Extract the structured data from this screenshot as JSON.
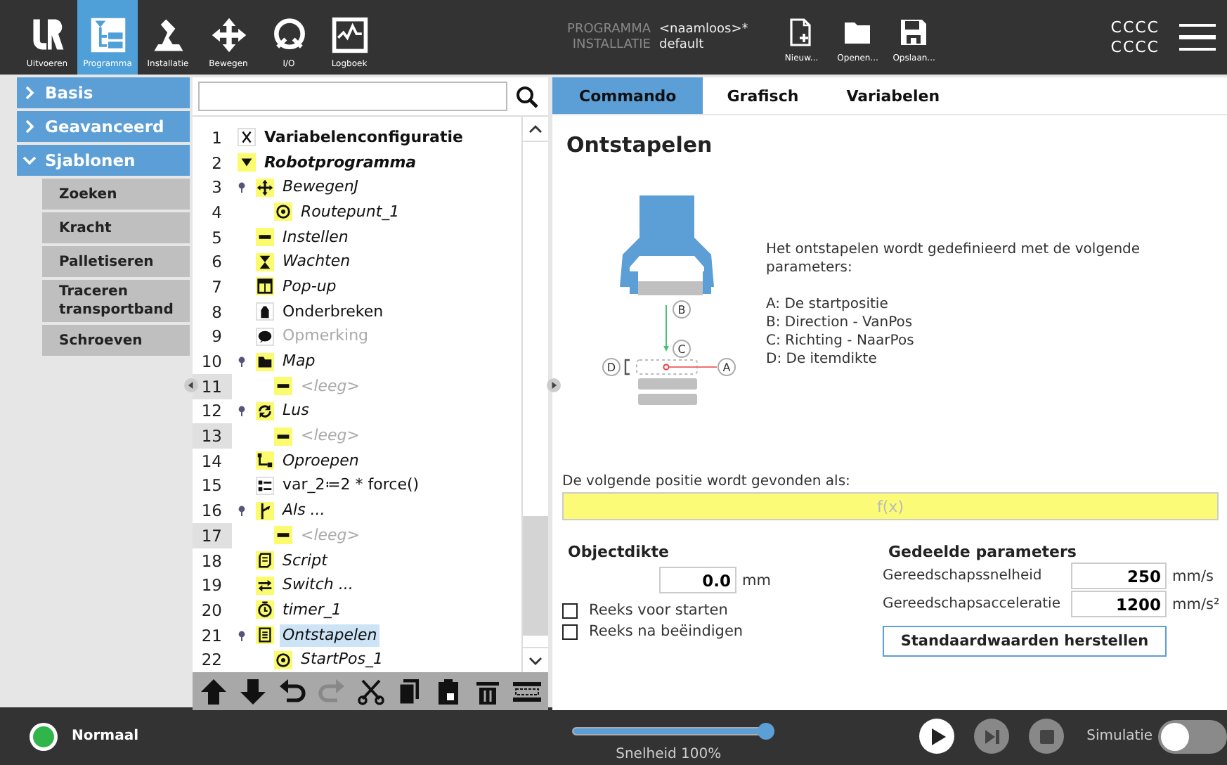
{
  "header": {
    "nav": [
      {
        "label": "Uitvoeren",
        "kind": "logo",
        "selected": false
      },
      {
        "label": "Programma",
        "kind": "program",
        "selected": true
      },
      {
        "label": "Installatie",
        "kind": "robot",
        "selected": false
      },
      {
        "label": "Bewegen",
        "kind": "move",
        "selected": false
      },
      {
        "label": "I/O",
        "kind": "io",
        "selected": false
      },
      {
        "label": "Logboek",
        "kind": "log",
        "selected": false
      }
    ],
    "program_label": "PROGRAMMA",
    "program_name": "<naamloos>*",
    "installation_label": "INSTALLATIE",
    "installation_name": "default",
    "files": [
      {
        "label": "Nieuw...",
        "kind": "new"
      },
      {
        "label": "Openen...",
        "kind": "open"
      },
      {
        "label": "Opslaan...",
        "kind": "save"
      }
    ],
    "user_lines": [
      "CCCC",
      "CCCC"
    ]
  },
  "sidebar": {
    "sections": [
      {
        "label": "Basis",
        "expanded": false
      },
      {
        "label": "Geavanceerd",
        "expanded": false
      },
      {
        "label": "Sjablonen",
        "expanded": true,
        "items": [
          "Zoeken",
          "Kracht",
          "Palletiseren",
          "Traceren transportband",
          "Schroeven"
        ]
      }
    ]
  },
  "tree": {
    "items": [
      {
        "line": "1",
        "label": "Variabelenconfiguratie",
        "kind": "variables",
        "italic": false,
        "disabled": false,
        "selected": false
      },
      {
        "line": "2",
        "label": "Robotprogramma",
        "kind": "program",
        "italic": true,
        "disabled": false,
        "selected": false,
        "children": [
          {
            "line": "3",
            "label": "BewegenJ",
            "kind": "move",
            "italic": true,
            "disabled": false,
            "selected": false,
            "children": [
              {
                "line": "4",
                "label": "Routepunt_1",
                "kind": "waypoint",
                "italic": true,
                "disabled": false,
                "selected": false
              }
            ]
          },
          {
            "line": "5",
            "label": "Instellen",
            "kind": "set",
            "italic": true,
            "disabled": false,
            "selected": false
          },
          {
            "line": "6",
            "label": "Wachten",
            "kind": "wait",
            "italic": true,
            "disabled": false,
            "selected": false
          },
          {
            "line": "7",
            "label": "Pop-up",
            "kind": "popup",
            "italic": true,
            "disabled": false,
            "selected": false
          },
          {
            "line": "8",
            "label": "Onderbreken",
            "kind": "halt",
            "italic": false,
            "disabled": false,
            "selected": false
          },
          {
            "line": "9",
            "label": "Opmerking",
            "kind": "comment",
            "italic": false,
            "disabled": true,
            "selected": false
          },
          {
            "line": "10",
            "label": "Map",
            "kind": "folder",
            "italic": true,
            "disabled": false,
            "selected": false,
            "children": [
              {
                "line": "11",
                "label": "<leeg>",
                "kind": "empty",
                "italic": true,
                "disabled": true,
                "selected": false
              }
            ]
          },
          {
            "line": "12",
            "label": "Lus",
            "kind": "loop",
            "italic": true,
            "disabled": false,
            "selected": false,
            "children": [
              {
                "line": "13",
                "label": "<leeg>",
                "kind": "empty",
                "italic": true,
                "disabled": true,
                "selected": false
              }
            ]
          },
          {
            "line": "14",
            "label": "Oproepen",
            "kind": "call",
            "italic": true,
            "disabled": false,
            "selected": false
          },
          {
            "line": "15",
            "label": "var_2≔2 * force()",
            "kind": "assignment",
            "italic": false,
            "disabled": false,
            "selected": false
          },
          {
            "line": "16",
            "label": "Als ...",
            "kind": "if",
            "italic": true,
            "disabled": false,
            "selected": false,
            "children": [
              {
                "line": "17",
                "label": "<leeg>",
                "kind": "empty",
                "italic": true,
                "disabled": true,
                "selected": false
              }
            ]
          },
          {
            "line": "18",
            "label": "Script",
            "kind": "script",
            "italic": true,
            "disabled": false,
            "selected": false
          },
          {
            "line": "19",
            "label": "Switch ...",
            "kind": "switch",
            "italic": true,
            "disabled": false,
            "selected": false
          },
          {
            "line": "20",
            "label": "timer_1",
            "kind": "timer",
            "italic": true,
            "disabled": false,
            "selected": false
          },
          {
            "line": "21",
            "label": "Ontstapelen",
            "kind": "destack",
            "italic": true,
            "disabled": false,
            "selected": true,
            "children": [
              {
                "line": "22",
                "label": "StartPos_1",
                "kind": "waypoint",
                "italic": true,
                "disabled": false,
                "selected": false
              }
            ]
          }
        ]
      }
    ],
    "toolbar": [
      {
        "kind": "up",
        "disabled": false
      },
      {
        "kind": "down",
        "disabled": false
      },
      {
        "kind": "undo",
        "disabled": false
      },
      {
        "kind": "redo",
        "disabled": true
      },
      {
        "kind": "cut",
        "disabled": false
      },
      {
        "kind": "copy",
        "disabled": false
      },
      {
        "kind": "paste",
        "disabled": false
      },
      {
        "kind": "delete",
        "disabled": false
      },
      {
        "kind": "suppress",
        "disabled": false
      }
    ]
  },
  "tabs": [
    {
      "label": "Commando",
      "selected": true
    },
    {
      "label": "Grafisch",
      "selected": false
    },
    {
      "label": "Variabelen",
      "selected": false
    }
  ],
  "command": {
    "title": "Ontstapelen",
    "diagram_labels": [
      "A",
      "B",
      "C",
      "D"
    ],
    "description": "Het ontstapelen wordt gedefinieerd met de volgende parameters:",
    "parameters": [
      "A: De startpositie",
      "B: Direction - VanPos",
      "C: Richting - NaarPos",
      "D: De itemdikte"
    ],
    "expression_label": "De volgende positie wordt gevonden als:",
    "expression": {
      "placeholder": "f(x)"
    },
    "thickness": {
      "title": "Objectdikte",
      "value": "0.0",
      "unit": "mm"
    },
    "checkboxes": [
      {
        "label": "Reeks voor starten",
        "checked": false
      },
      {
        "label": "Reeks na beëindigen",
        "checked": false
      }
    ],
    "shared": {
      "title": "Gedeelde parameters",
      "rows": [
        {
          "label": "Gereedschapssnelheid",
          "value": "250",
          "unit": "mm/s"
        },
        {
          "label": "Gereedschapsacceleratie",
          "value": "1200",
          "unit": "mm/s²"
        }
      ],
      "button": "Standaardwaarden herstellen"
    }
  },
  "footer": {
    "status": "Normaal",
    "speed": {
      "level": 1.0,
      "label": "Snelheid 100%"
    },
    "controls": [
      {
        "kind": "play",
        "disabled": false
      },
      {
        "kind": "step",
        "disabled": true
      },
      {
        "kind": "stop",
        "disabled": true
      }
    ],
    "simulation": {
      "label": "Simulatie",
      "on": false
    }
  }
}
